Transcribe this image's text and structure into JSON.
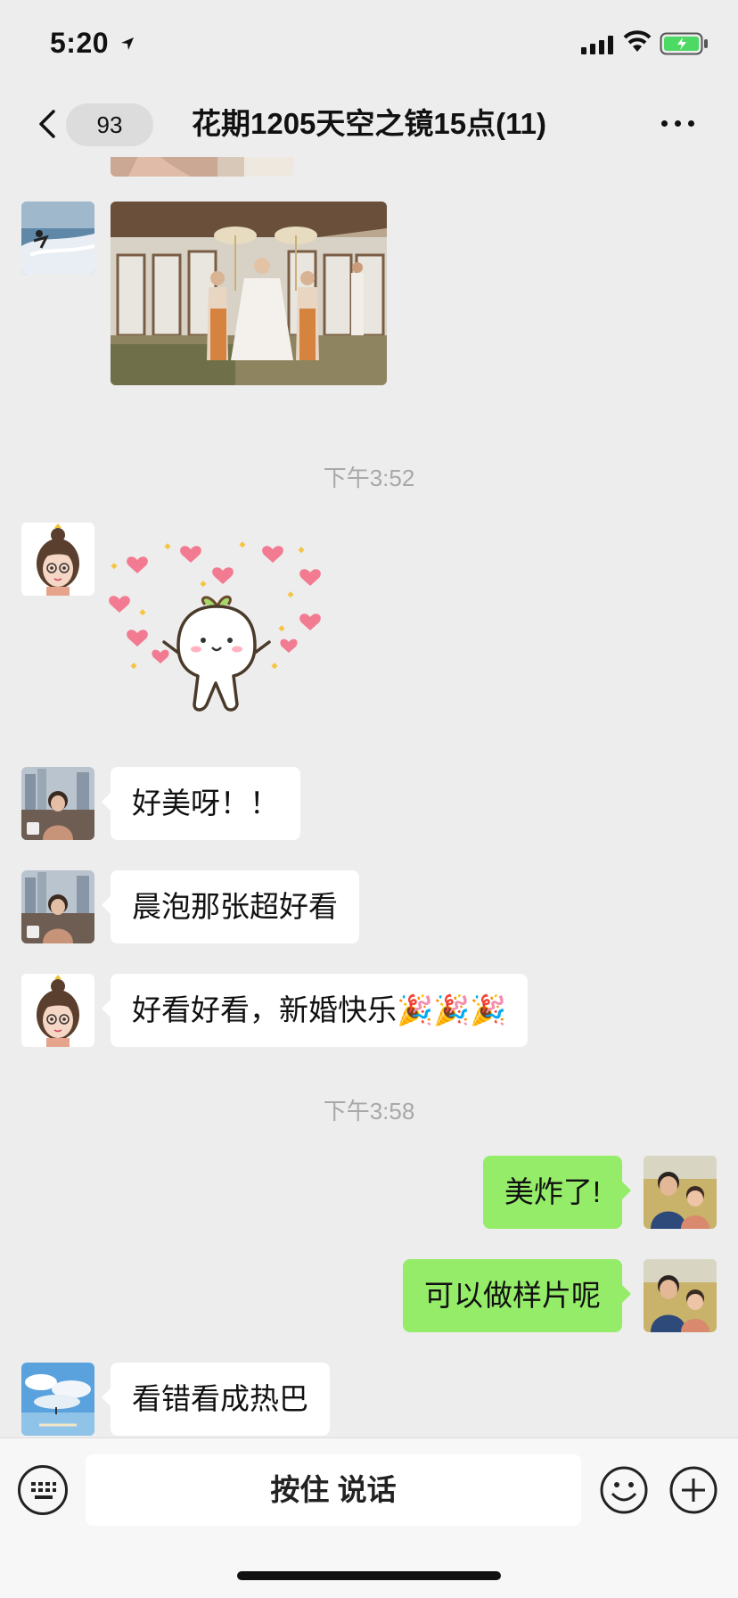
{
  "status_bar": {
    "time": "5:20"
  },
  "nav": {
    "back_count": "93",
    "title": "花期1205天空之镜15点(11)"
  },
  "messages": {
    "time_1": "下午3:52",
    "msg_1": "好美呀！！",
    "msg_2": "晨泡那张超好看",
    "msg_3": "好看好看，新婚快乐🎉🎉🎉",
    "time_2": "下午3:58",
    "msg_4": "美炸了!",
    "msg_5": "可以做样片呢",
    "msg_6": "看错看成热巴"
  },
  "input_bar": {
    "hold_to_talk": "按住 说话"
  },
  "colors": {
    "background": "#ededed",
    "bubble_mine": "#95ec69",
    "bubble_other": "#ffffff",
    "timestamp": "#a8a8a8",
    "battery_fill": "#4cd964"
  },
  "icons": [
    "location-arrow-icon",
    "signal-icon",
    "wifi-icon",
    "battery-icon",
    "back-chevron-icon",
    "more-icon",
    "keyboard-icon",
    "emoji-icon",
    "plus-icon"
  ]
}
